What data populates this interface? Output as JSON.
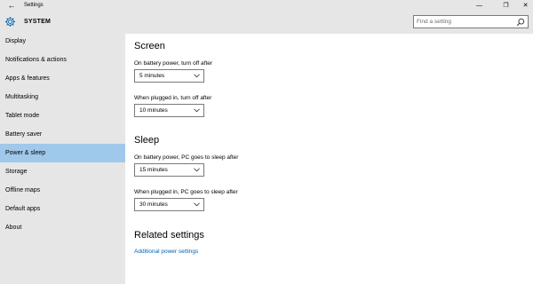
{
  "window": {
    "title": "Settings",
    "back_glyph": "←",
    "min_glyph": "—",
    "max_glyph": "❐",
    "close_glyph": "✕"
  },
  "sidebar": {
    "header": "SYSTEM",
    "header_icon": "gear-icon",
    "items": [
      {
        "label": "Display"
      },
      {
        "label": "Notifications & actions"
      },
      {
        "label": "Apps & features"
      },
      {
        "label": "Multitasking"
      },
      {
        "label": "Tablet mode"
      },
      {
        "label": "Battery saver"
      },
      {
        "label": "Power & sleep",
        "selected": true
      },
      {
        "label": "Storage"
      },
      {
        "label": "Offline maps"
      },
      {
        "label": "Default apps"
      },
      {
        "label": "About"
      }
    ]
  },
  "search": {
    "placeholder": "Find a setting",
    "icon": "search-icon"
  },
  "screen": {
    "title": "Screen",
    "battery_label": "On battery power, turn off after",
    "battery_value": "5 minutes",
    "plugged_label": "When plugged in, turn off after",
    "plugged_value": "10 minutes"
  },
  "sleep": {
    "title": "Sleep",
    "battery_label": "On battery power, PC goes to sleep after",
    "battery_value": "15 minutes",
    "plugged_label": "When plugged in, PC goes to sleep after",
    "plugged_value": "30 minutes"
  },
  "related": {
    "title": "Related settings",
    "link": "Additional power settings"
  },
  "colors": {
    "sidebar_bg": "#e6e6e6",
    "selected_bg": "#a0c8ea",
    "link": "#0063b1",
    "accent_icon": "#0063b1"
  }
}
